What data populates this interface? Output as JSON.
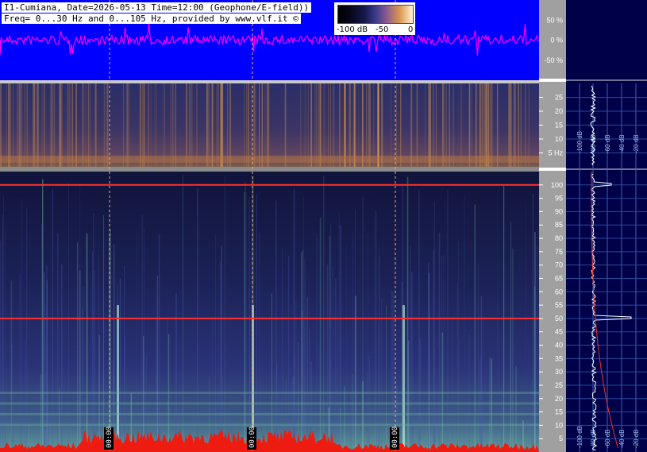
{
  "header": {
    "line1": "I1-Cumiana, Date=2026-05-13 Time=12:00 (Geophone/E-field))",
    "line2": "Freq= 0...30 Hz and 0...105 Hz, provided by www.vlf.it ©"
  },
  "colorbar": {
    "ticks": [
      "-100 dB",
      "-50",
      "0"
    ]
  },
  "time_markers": [
    "00:00",
    "00:00",
    "00:00"
  ],
  "chart_data": [
    {
      "type": "line",
      "panel": "waveform",
      "ylabels": [
        "50 %",
        "0 %",
        "-50 %"
      ],
      "y_ticks": [
        50,
        0,
        -50
      ],
      "ylim": [
        -100,
        100
      ],
      "colors": {
        "background": "#0000ff",
        "trace": "#ff00ff"
      }
    },
    {
      "type": "heatmap",
      "panel": "spectrogram 0-30 Hz",
      "ylim": [
        0,
        30
      ],
      "y_ticks": [
        5,
        10,
        15,
        20,
        25
      ],
      "ylabels": [
        "5 Hz",
        "10",
        "15",
        "20",
        "25"
      ],
      "side_axis_labels": [
        "-100 dB",
        "-80 dB",
        "-60 dB",
        "-40 dB",
        "-20 dB"
      ]
    },
    {
      "type": "heatmap",
      "panel": "spectrogram 0-105 Hz",
      "ylim": [
        0,
        105
      ],
      "y_ticks": [
        5,
        10,
        15,
        20,
        25,
        30,
        35,
        40,
        45,
        50,
        55,
        60,
        65,
        70,
        75,
        80,
        85,
        90,
        95,
        100
      ],
      "ylabels": [
        "5",
        "10",
        "15",
        "20",
        "25",
        "30",
        "35",
        "40",
        "45",
        "50",
        "55",
        "60",
        "65",
        "70",
        "75",
        "80",
        "85",
        "90",
        "95",
        "100"
      ],
      "side_axis_labels": [
        "-100 dB",
        "-80 dB",
        "-60 dB",
        "-40 dB",
        "-20 dB"
      ],
      "lines_hz": [
        50,
        100
      ]
    }
  ]
}
